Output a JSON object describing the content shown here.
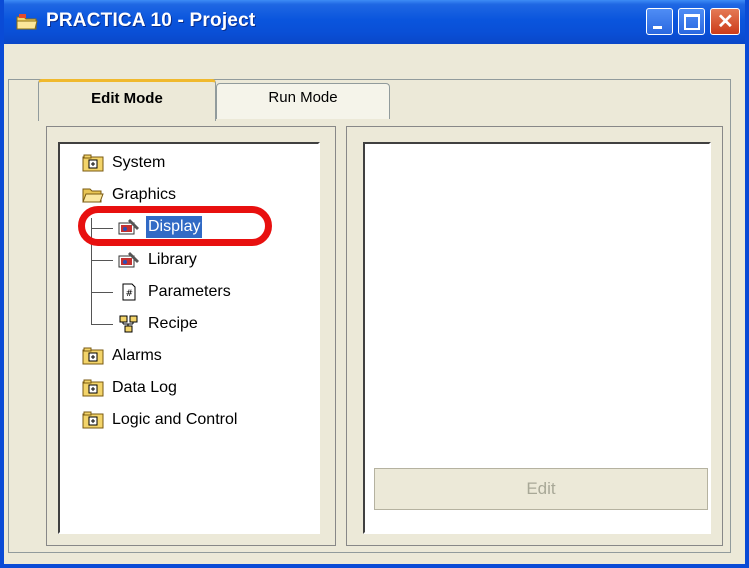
{
  "window": {
    "title": "PRACTICA 10 - Project"
  },
  "tabs": [
    {
      "label": "Edit Mode",
      "active": true
    },
    {
      "label": "Run Mode",
      "active": false
    }
  ],
  "tree": {
    "system": "System",
    "graphics": "Graphics",
    "display": "Display",
    "library": "Library",
    "parameters": "Parameters",
    "recipe": "Recipe",
    "alarms": "Alarms",
    "data_log": "Data Log",
    "logic_control": "Logic and Control"
  },
  "selected_item": "Display",
  "buttons": {
    "edit": "Edit"
  },
  "colors": {
    "titlebar": "#0a55dd",
    "selection": "#316ac5",
    "highlight_ring": "#e8100f",
    "tab_accent": "#f0b92d"
  }
}
